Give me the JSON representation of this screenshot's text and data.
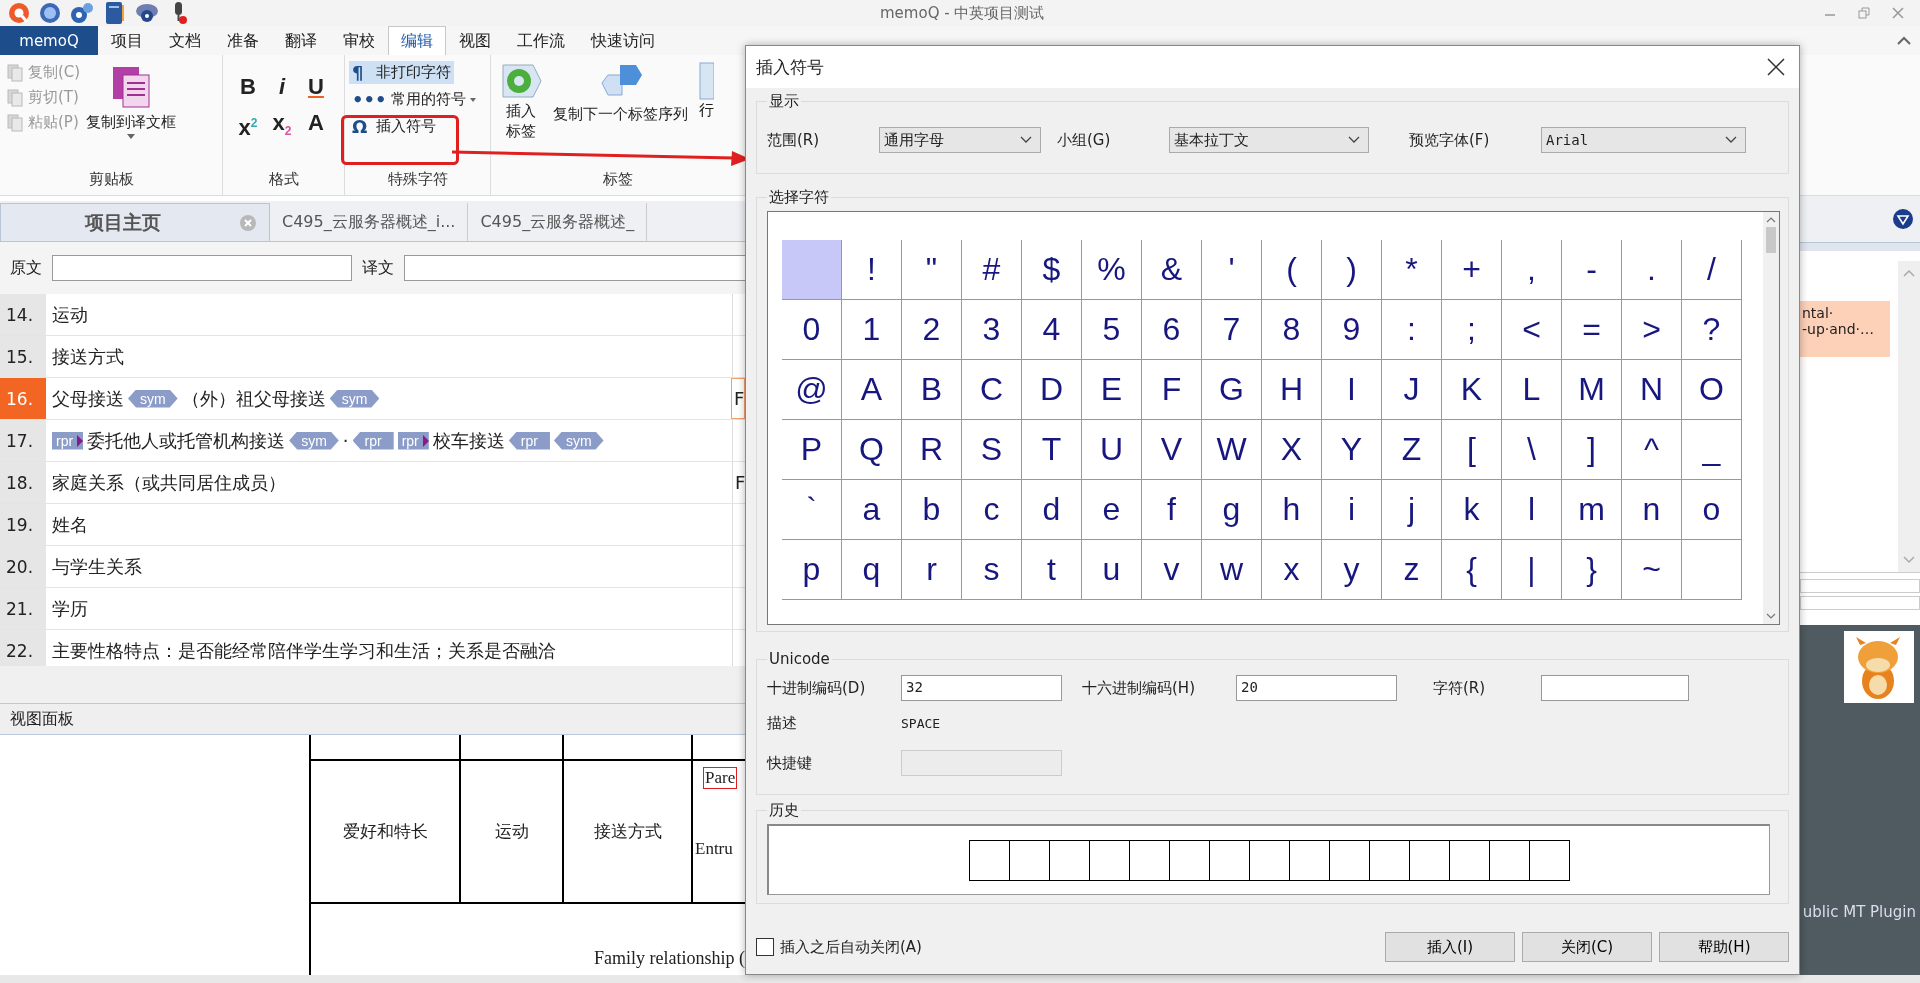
{
  "window": {
    "title": "memoQ - 中英项目测试"
  },
  "ribbon": {
    "app_tab": "memoQ",
    "tabs": [
      {
        "label": "项目",
        "selected": false
      },
      {
        "label": "文档",
        "selected": false
      },
      {
        "label": "准备",
        "selected": false
      },
      {
        "label": "翻译",
        "selected": false
      },
      {
        "label": "审校",
        "selected": false
      },
      {
        "label": "编辑",
        "selected": true
      },
      {
        "label": "视图",
        "selected": false
      },
      {
        "label": "工作流",
        "selected": false
      },
      {
        "label": "快速访问",
        "selected": false
      }
    ],
    "clipboard": {
      "label": "剪贴板",
      "small_buttons": [
        {
          "label": "复制(C)",
          "disabled": true
        },
        {
          "label": "剪切(T)",
          "disabled": true
        },
        {
          "label": "粘贴(P)",
          "disabled": true
        }
      ],
      "large_button": "复制到译文框"
    },
    "format": {
      "label": "格式",
      "buttons": [
        {
          "text": "B",
          "kind": "bold"
        },
        {
          "text": "i",
          "kind": "italic"
        },
        {
          "text": "U",
          "kind": "underline"
        },
        {
          "text": "x$^{2}$",
          "kind": "superscript"
        },
        {
          "text": "x$_{2}$",
          "kind": "subscript"
        },
        {
          "text": "A",
          "kind": "font"
        }
      ]
    },
    "special": {
      "label": "特殊字符",
      "buttons": [
        {
          "icon": "¶",
          "label": "非打印字符",
          "selected": true,
          "dropdown": false
        },
        {
          "icon": "•••",
          "label": "常用的符号",
          "selected": false,
          "dropdown": true
        },
        {
          "icon": "Ω",
          "label": "插入符号",
          "selected": false,
          "dropdown": false
        }
      ]
    },
    "tags": {
      "label": "标签",
      "insert_lines": [
        "插入",
        "标签"
      ],
      "copy_sequence": "复制下一个标签序列",
      "row_button": "行"
    }
  },
  "document_tabs": [
    {
      "label": "项目主页",
      "selected": true,
      "closable": true
    },
    {
      "label": "C495_云服务器概述_i...",
      "selected": false,
      "closable": false
    },
    {
      "label": "C495_云服务器概述_",
      "selected": false,
      "closable": false
    }
  ],
  "filter": {
    "source_label": "原文",
    "target_label": "译文"
  },
  "segments": [
    {
      "number": "14.",
      "selected": false,
      "source": [
        {
          "kind": "text",
          "text": "运动"
        }
      ]
    },
    {
      "number": "15.",
      "selected": false,
      "source": [
        {
          "kind": "text",
          "text": "接送方式"
        }
      ]
    },
    {
      "number": "16.",
      "selected": true,
      "source": [
        {
          "kind": "text",
          "text": "父母接送"
        },
        {
          "kind": "symbol-tag",
          "text": "sym"
        },
        {
          "kind": "text",
          "text": "（外）祖父母接送"
        },
        {
          "kind": "symbol-tag",
          "text": "sym"
        }
      ],
      "target": "F"
    },
    {
      "number": "17.",
      "selected": false,
      "source": [
        {
          "kind": "open-tag",
          "text": "rpr"
        },
        {
          "kind": "text",
          "text": "委托他人或托管机构接送"
        },
        {
          "kind": "symbol-tag",
          "text": "sym"
        },
        {
          "kind": "text",
          "text": "·"
        },
        {
          "kind": "close-tag",
          "text": "rpr"
        },
        {
          "kind": "open-tag",
          "text": "rpr"
        },
        {
          "kind": "text",
          "text": "校车接送"
        },
        {
          "kind": "close-tag",
          "text": "rpr"
        },
        {
          "kind": "symbol-tag",
          "text": "sym"
        }
      ]
    },
    {
      "number": "18.",
      "selected": false,
      "source": [
        {
          "kind": "text",
          "text": "家庭关系（或共同居住成员）"
        }
      ],
      "target": "F"
    },
    {
      "number": "19.",
      "selected": false,
      "source": [
        {
          "kind": "text",
          "text": "姓名"
        }
      ]
    },
    {
      "number": "20.",
      "selected": false,
      "source": [
        {
          "kind": "text",
          "text": "与学生关系"
        }
      ]
    },
    {
      "number": "21.",
      "selected": false,
      "source": [
        {
          "kind": "text",
          "text": "学历"
        }
      ]
    },
    {
      "number": "22.",
      "selected": false,
      "source": [
        {
          "kind": "text",
          "text": "主要性格特点：是否能经常陪伴学生学习和生活；关系是否融洽"
        }
      ]
    }
  ],
  "view_panel": {
    "title": "视图面板",
    "cells": [
      "爱好和特长",
      "运动",
      "接送方式"
    ],
    "highlighted": "Pare",
    "cut_text": "Entru",
    "footer": "Family relationship ("
  },
  "side_panel": {
    "entry_lines": [
      "ntal·",
      "-up·and·…"
    ],
    "plugin_label": "ublic MT Plugin"
  },
  "dialog": {
    "title": "插入符号",
    "display": {
      "label": "显示",
      "range_label": "范围(R)",
      "range": "通用字母",
      "group_label": "小组(G)",
      "group": "基本拉丁文",
      "font_label": "预览字体(F)",
      "font": "Arial"
    },
    "chars_label": "选择字符",
    "chars": [
      {
        "selected": true
      },
      {
        "char": "!",
        "selected": false
      },
      {
        "char": "\"",
        "selected": false
      },
      {
        "char": "#",
        "selected": false
      },
      {
        "char": "$",
        "selected": false
      },
      {
        "char": "%",
        "selected": false
      },
      {
        "char": "&",
        "selected": false
      },
      {
        "char": "'",
        "selected": false
      },
      {
        "char": "(",
        "selected": false
      },
      {
        "char": ")",
        "selected": false
      },
      {
        "char": "*",
        "selected": false
      },
      {
        "char": "+",
        "selected": false
      },
      {
        "char": ",",
        "selected": false
      },
      {
        "char": "-",
        "selected": false
      },
      {
        "char": ".",
        "selected": false
      },
      {
        "char": "/",
        "selected": false
      },
      {
        "char": "0",
        "selected": false
      },
      {
        "char": "1",
        "selected": false
      },
      {
        "char": "2",
        "selected": false
      },
      {
        "char": "3",
        "selected": false
      },
      {
        "char": "4",
        "selected": false
      },
      {
        "char": "5",
        "selected": false
      },
      {
        "char": "6",
        "selected": false
      },
      {
        "char": "7",
        "selected": false
      },
      {
        "char": "8",
        "selected": false
      },
      {
        "char": "9",
        "selected": false
      },
      {
        "char": ":",
        "selected": false
      },
      {
        "char": ";",
        "selected": false
      },
      {
        "char": "<",
        "selected": false
      },
      {
        "char": "=",
        "selected": false
      },
      {
        "char": ">",
        "selected": false
      },
      {
        "char": "?",
        "selected": false
      },
      {
        "char": "@",
        "selected": false
      },
      {
        "char": "A",
        "selected": false
      },
      {
        "char": "B",
        "selected": false
      },
      {
        "char": "C",
        "selected": false
      },
      {
        "char": "D",
        "selected": false
      },
      {
        "char": "E",
        "selected": false
      },
      {
        "char": "F",
        "selected": false
      },
      {
        "char": "G",
        "selected": false
      },
      {
        "char": "H",
        "selected": false
      },
      {
        "char": "I",
        "selected": false
      },
      {
        "char": "J",
        "selected": false
      },
      {
        "char": "K",
        "selected": false
      },
      {
        "char": "L",
        "selected": false
      },
      {
        "char": "M",
        "selected": false
      },
      {
        "char": "N",
        "selected": false
      },
      {
        "char": "O",
        "selected": false
      },
      {
        "char": "P",
        "selected": false
      },
      {
        "char": "Q",
        "selected": false
      },
      {
        "char": "R",
        "selected": false
      },
      {
        "char": "S",
        "selected": false
      },
      {
        "char": "T",
        "selected": false
      },
      {
        "char": "U",
        "selected": false
      },
      {
        "char": "V",
        "selected": false
      },
      {
        "char": "W",
        "selected": false
      },
      {
        "char": "X",
        "selected": false
      },
      {
        "char": "Y",
        "selected": false
      },
      {
        "char": "Z",
        "selected": false
      },
      {
        "char": "[",
        "selected": false
      },
      {
        "char": "\\",
        "selected": false
      },
      {
        "char": "]",
        "selected": false
      },
      {
        "char": "^",
        "selected": false
      },
      {
        "char": "_",
        "selected": false
      },
      {
        "char": "`",
        "selected": false
      },
      {
        "char": "a",
        "selected": false
      },
      {
        "char": "b",
        "selected": false
      },
      {
        "char": "c",
        "selected": false
      },
      {
        "char": "d",
        "selected": false
      },
      {
        "char": "e",
        "selected": false
      },
      {
        "char": "f",
        "selected": false
      },
      {
        "char": "g",
        "selected": false
      },
      {
        "char": "h",
        "selected": false
      },
      {
        "char": "i",
        "selected": false
      },
      {
        "char": "j",
        "selected": false
      },
      {
        "char": "k",
        "selected": false
      },
      {
        "char": "l",
        "selected": false
      },
      {
        "char": "m",
        "selected": false
      },
      {
        "char": "n",
        "selected": false
      },
      {
        "char": "o",
        "selected": false
      },
      {
        "char": "p",
        "selected": false
      },
      {
        "char": "q",
        "selected": false
      },
      {
        "char": "r",
        "selected": false
      },
      {
        "char": "s",
        "selected": false
      },
      {
        "char": "t",
        "selected": false
      },
      {
        "char": "u",
        "selected": false
      },
      {
        "char": "v",
        "selected": false
      },
      {
        "char": "w",
        "selected": false
      },
      {
        "char": "x",
        "selected": false
      },
      {
        "char": "y",
        "selected": false
      },
      {
        "char": "z",
        "selected": false
      },
      {
        "char": "{",
        "selected": false
      },
      {
        "char": "|",
        "selected": false
      },
      {
        "char": "}",
        "selected": false
      },
      {
        "char": "~",
        "selected": false
      },
      {
        "selected": false
      }
    ],
    "unicode": {
      "label": "Unicode",
      "decimal_label": "十进制编码(D)",
      "decimal": "32",
      "hex_label": "十六进制编码(H)",
      "hex": "20",
      "char_label": "字符(R)",
      "description_label": "描述",
      "description": "SPACE",
      "shortcut_label": "快捷键",
      "shortcut_disabled": true
    },
    "history_label": "历史",
    "auto_close": {
      "label": "插入之后自动关闭(A)",
      "checked": false
    },
    "buttons": [
      "插入(I)",
      "关闭(C)",
      "帮助(H)"
    ]
  }
}
